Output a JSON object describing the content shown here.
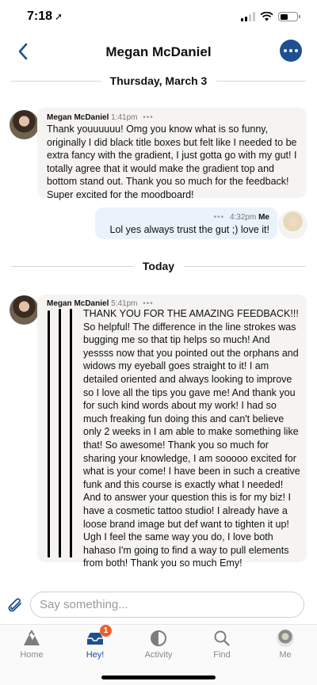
{
  "status_bar": {
    "time": "7:18",
    "location_glyph": "➚"
  },
  "header": {
    "title": "Megan McDaniel"
  },
  "separators": {
    "first": "Thursday, March 3",
    "second": "Today"
  },
  "messages": [
    {
      "sender": "Megan McDaniel",
      "time": "1:41pm",
      "dots": "•••",
      "text": "Thank youuuuuu! Omg you know what is so funny, originally I did black title boxes but felt like I needed to be extra fancy with the gradient, I just gotta go with my gut! I totally agree that it would make the gradient top and bottom stand out. Thank you so much for the feedback! Super excited for the moodboard!"
    },
    {
      "sender": "Me",
      "time": "4:32pm",
      "dots": "•••",
      "text": "Lol yes always trust the gut ;) love it!"
    },
    {
      "sender": "Megan McDaniel",
      "time": "5:41pm",
      "dots": "•••",
      "text": "THANK YOU FOR THE AMAZING FEEDBACK!!! So helpful! The difference in the line strokes was bugging me so that tip helps so much! And yessss now that you pointed out the orphans and widows my eyeball goes straight to it! I am detailed oriented and always looking to improve so I love all the tips you gave me! And thank you for such kind words about my work! I had so much freaking fun doing this and can't believe only 2 weeks in I am able to make something like that! So awesome! Thank you so much for sharing your knowledge, I am sooooo excited for what is your come! I have been in such a creative funk and this course is exactly what I needed! And to answer your question this is for my biz! I have a cosmetic tattoo studio! I already have a loose brand image but def want to tighten it up! Ugh I feel the same way you do, I love both hahaso I'm going to find a way to pull elements from both! Thank you so much Emy!"
    }
  ],
  "composer": {
    "placeholder": "Say something..."
  },
  "tabs": [
    {
      "label": "Home",
      "icon": "home-icon"
    },
    {
      "label": "Hey!",
      "icon": "inbox-icon",
      "badge": "1"
    },
    {
      "label": "Activity",
      "icon": "activity-icon"
    },
    {
      "label": "Find",
      "icon": "search-icon"
    },
    {
      "label": "Me",
      "icon": "profile-avatar"
    }
  ],
  "colors": {
    "accent": "#1d4f91",
    "badge": "#e8622b",
    "incoming_bubble": "#f5f4f2",
    "outgoing_bubble": "#eaf3fb"
  }
}
